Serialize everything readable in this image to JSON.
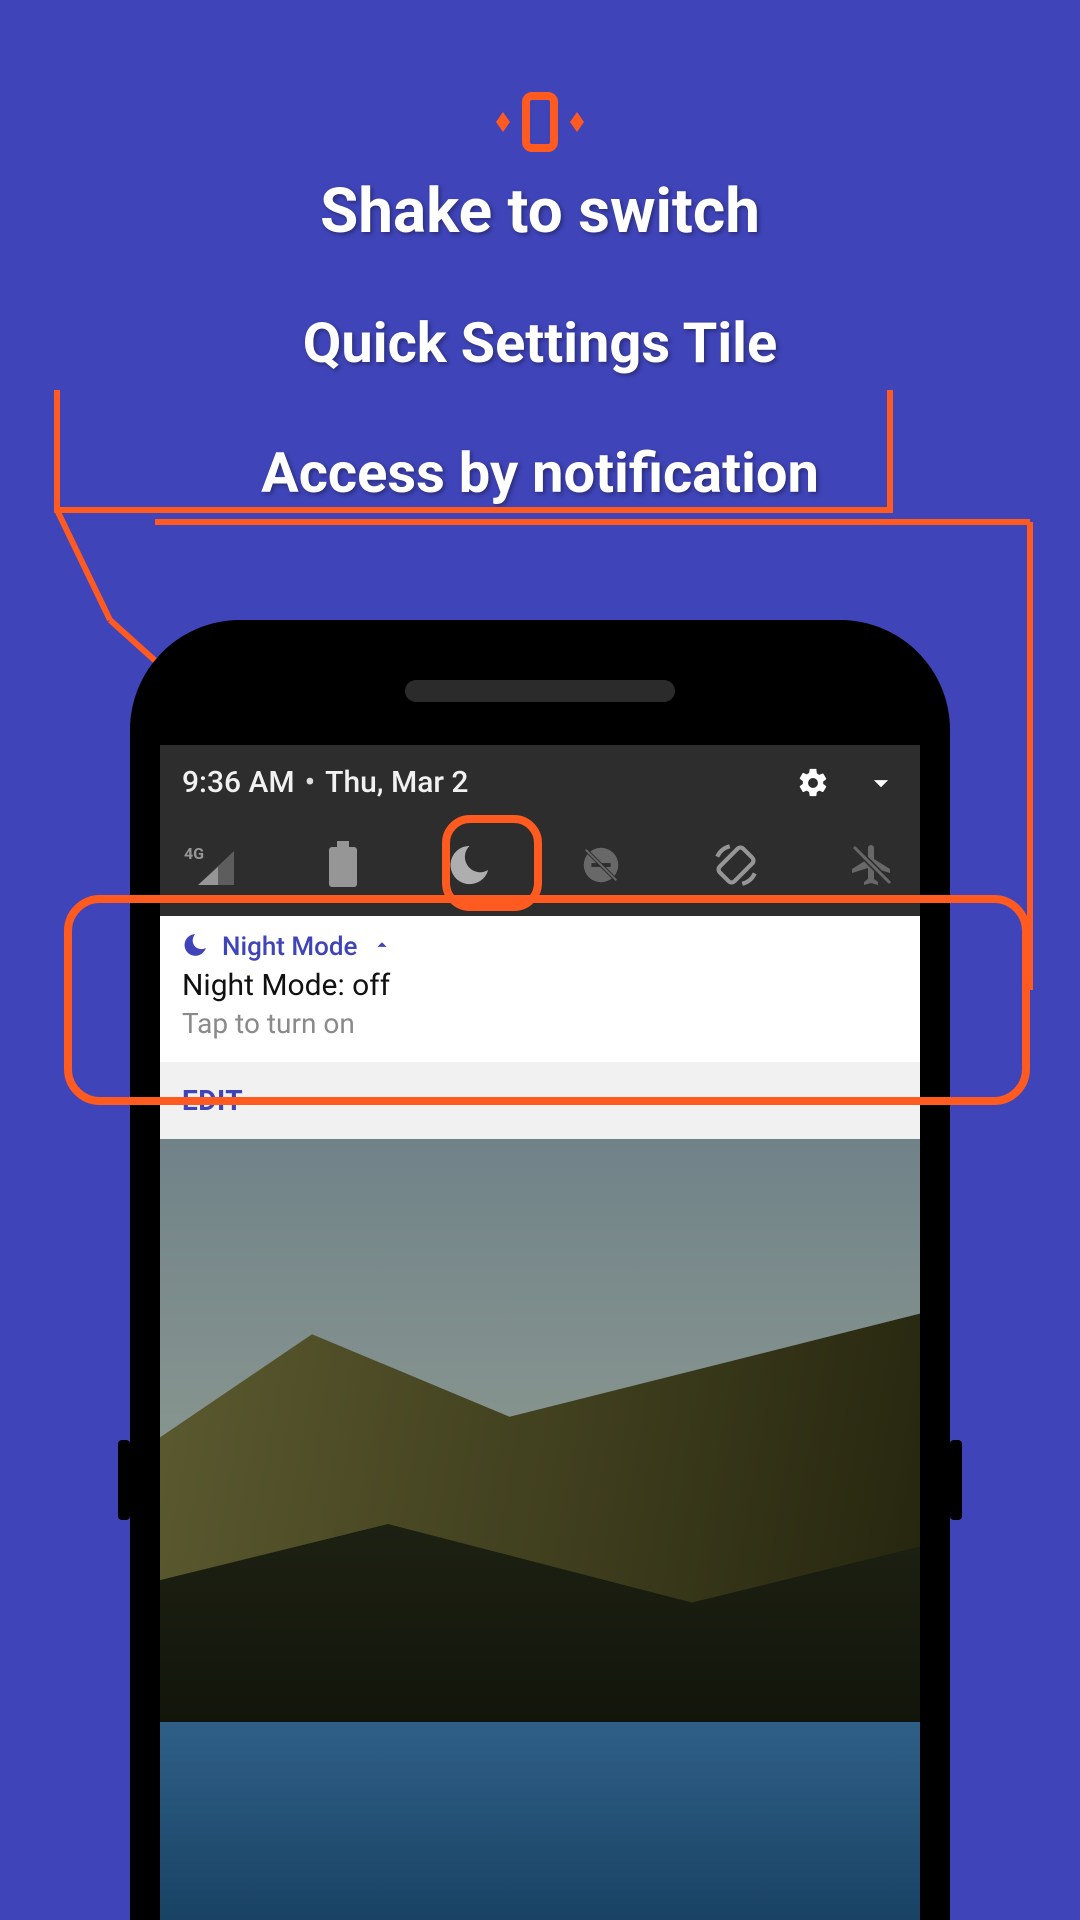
{
  "hero": {
    "icon_name": "shake-phone-icon",
    "color_accent": "#ff5a1f"
  },
  "headings": {
    "shake": "Shake to switch",
    "tile": "Quick Settings Tile",
    "notification": "Access by notification"
  },
  "quick_settings": {
    "time": "9:36 AM",
    "separator": "•",
    "date": "Thu, Mar 2",
    "icons": {
      "settings": "gear-icon",
      "expand": "chevron-down-icon"
    },
    "tiles": [
      {
        "name": "cellular-4g-icon",
        "label_small": "4G"
      },
      {
        "name": "battery-icon"
      },
      {
        "name": "moon-icon",
        "highlighted": true
      },
      {
        "name": "dnd-off-icon"
      },
      {
        "name": "auto-rotate-icon"
      },
      {
        "name": "airplane-off-icon"
      }
    ]
  },
  "notification": {
    "app_icon": "moon-icon",
    "app_name": "Night Mode",
    "expand_icon": "chevron-up-icon",
    "title": "Night Mode: off",
    "subtitle": "Tap to turn on",
    "actions": [
      {
        "id": "edit",
        "label": "EDIT"
      }
    ]
  },
  "colors": {
    "background": "#3f44b8",
    "accent": "#ff5a1f",
    "link": "#3f44b8"
  }
}
